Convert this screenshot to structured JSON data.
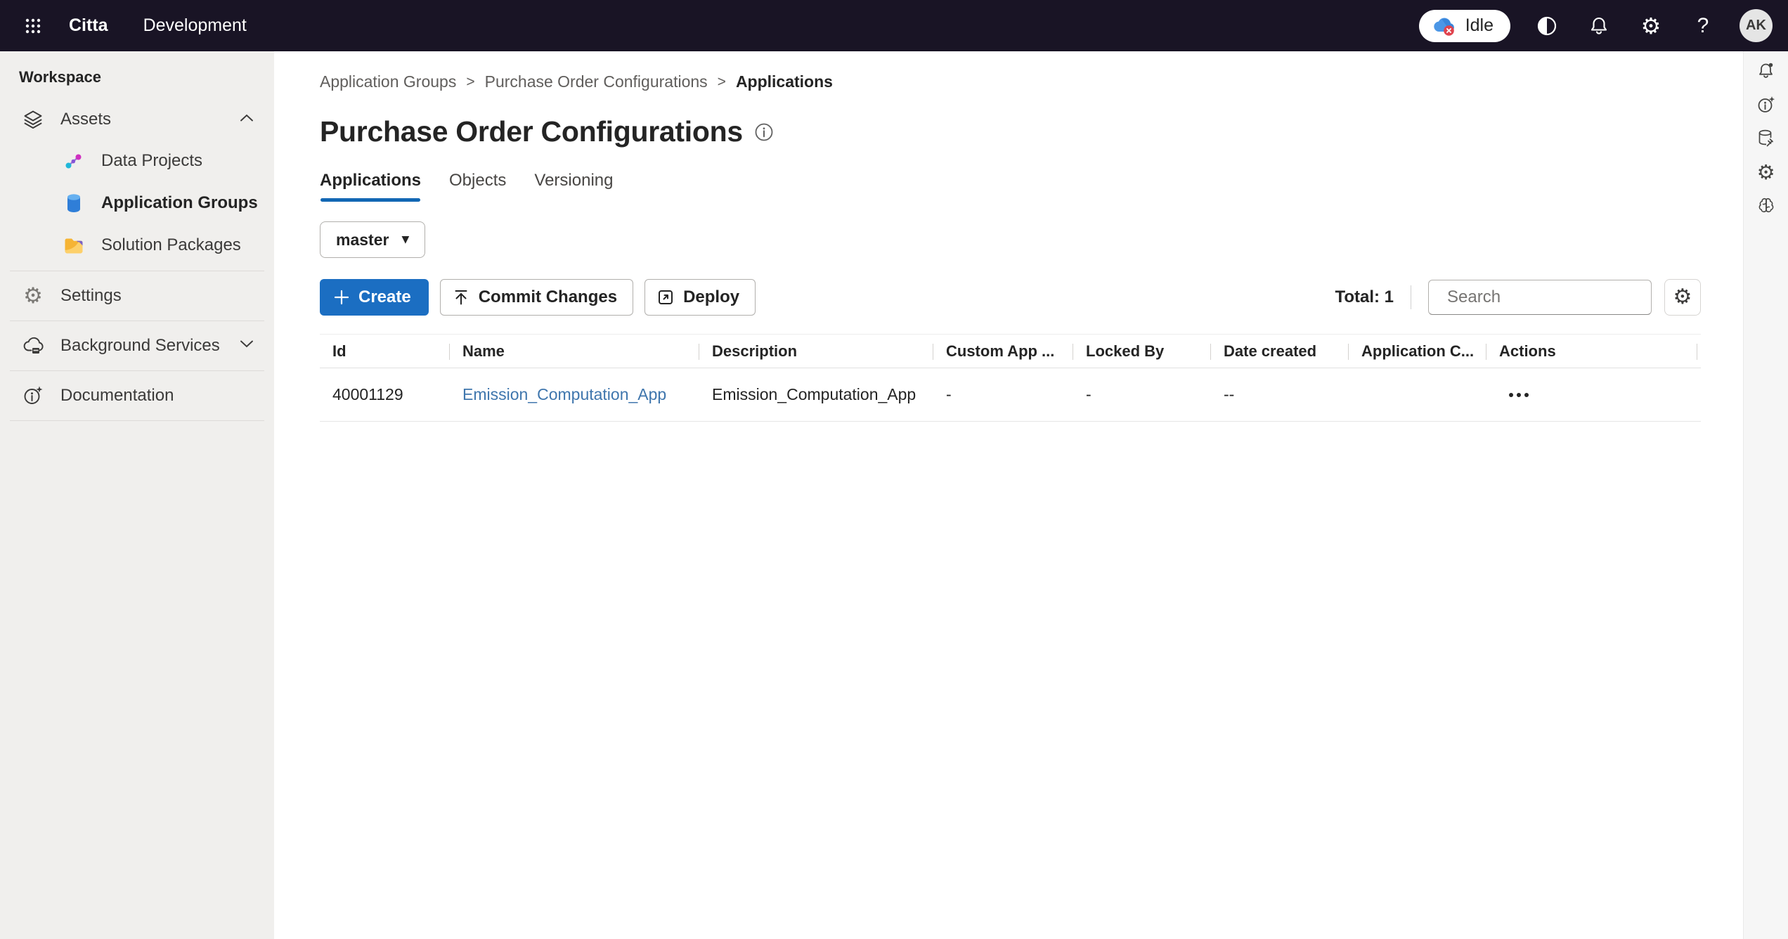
{
  "top_bar": {
    "app_name": "Citta",
    "environment": "Development",
    "status_badge": "Idle",
    "avatar_initials": "AK"
  },
  "sidebar": {
    "section_label": "Workspace",
    "items": [
      {
        "label": "Assets",
        "icon": "layers-icon",
        "expanded": true
      },
      {
        "label": "Data Projects",
        "icon": "data-projects-icon"
      },
      {
        "label": "Application Groups",
        "icon": "database-icon",
        "active": true
      },
      {
        "label": "Solution Packages",
        "icon": "folder-icon"
      },
      {
        "label": "Settings",
        "icon": "gear-icon"
      },
      {
        "label": "Background Services",
        "icon": "cloud-services-icon",
        "collapsed": true
      },
      {
        "label": "Documentation",
        "icon": "info-sparkle-icon"
      }
    ]
  },
  "right_rail": {
    "icons": [
      "bell-badge",
      "info-sparkle",
      "database-connector",
      "gear",
      "brain"
    ]
  },
  "breadcrumb": {
    "items": [
      "Application Groups",
      "Purchase Order Configurations",
      "Applications"
    ]
  },
  "page": {
    "title": "Purchase Order Configurations"
  },
  "tabs": [
    {
      "label": "Applications",
      "active": true
    },
    {
      "label": "Objects",
      "active": false
    },
    {
      "label": "Versioning",
      "active": false
    }
  ],
  "branch_selector": {
    "value": "master"
  },
  "toolbar": {
    "create_label": "Create",
    "commit_label": "Commit Changes",
    "deploy_label": "Deploy"
  },
  "table_controls": {
    "total_label": "Total: 1",
    "search_placeholder": "Search"
  },
  "table": {
    "columns": [
      "Id",
      "Name",
      "Description",
      "Custom App ...",
      "Locked By",
      "Date created",
      "Application C...",
      "Actions"
    ],
    "rows": [
      {
        "id": "40001129",
        "name": "Emission_Computation_App",
        "description": "Emission_Computation_App",
        "custom_app": "-",
        "locked_by": "-",
        "date_created": "--",
        "application_c": "",
        "actions_icon": "more-horizontal-icon"
      }
    ]
  },
  "glyphs": {
    "gear": "⚙",
    "help": "?",
    "caret": "▼"
  },
  "colors": {
    "topbar_bg": "#191425",
    "sidebar_bg": "#f0efed",
    "accent": "#1b6ec2",
    "tab_underline": "#1267b4",
    "link": "#3f76ad",
    "status_error_badge": "#e0434e",
    "cloud_blue": "#4b96e6"
  }
}
